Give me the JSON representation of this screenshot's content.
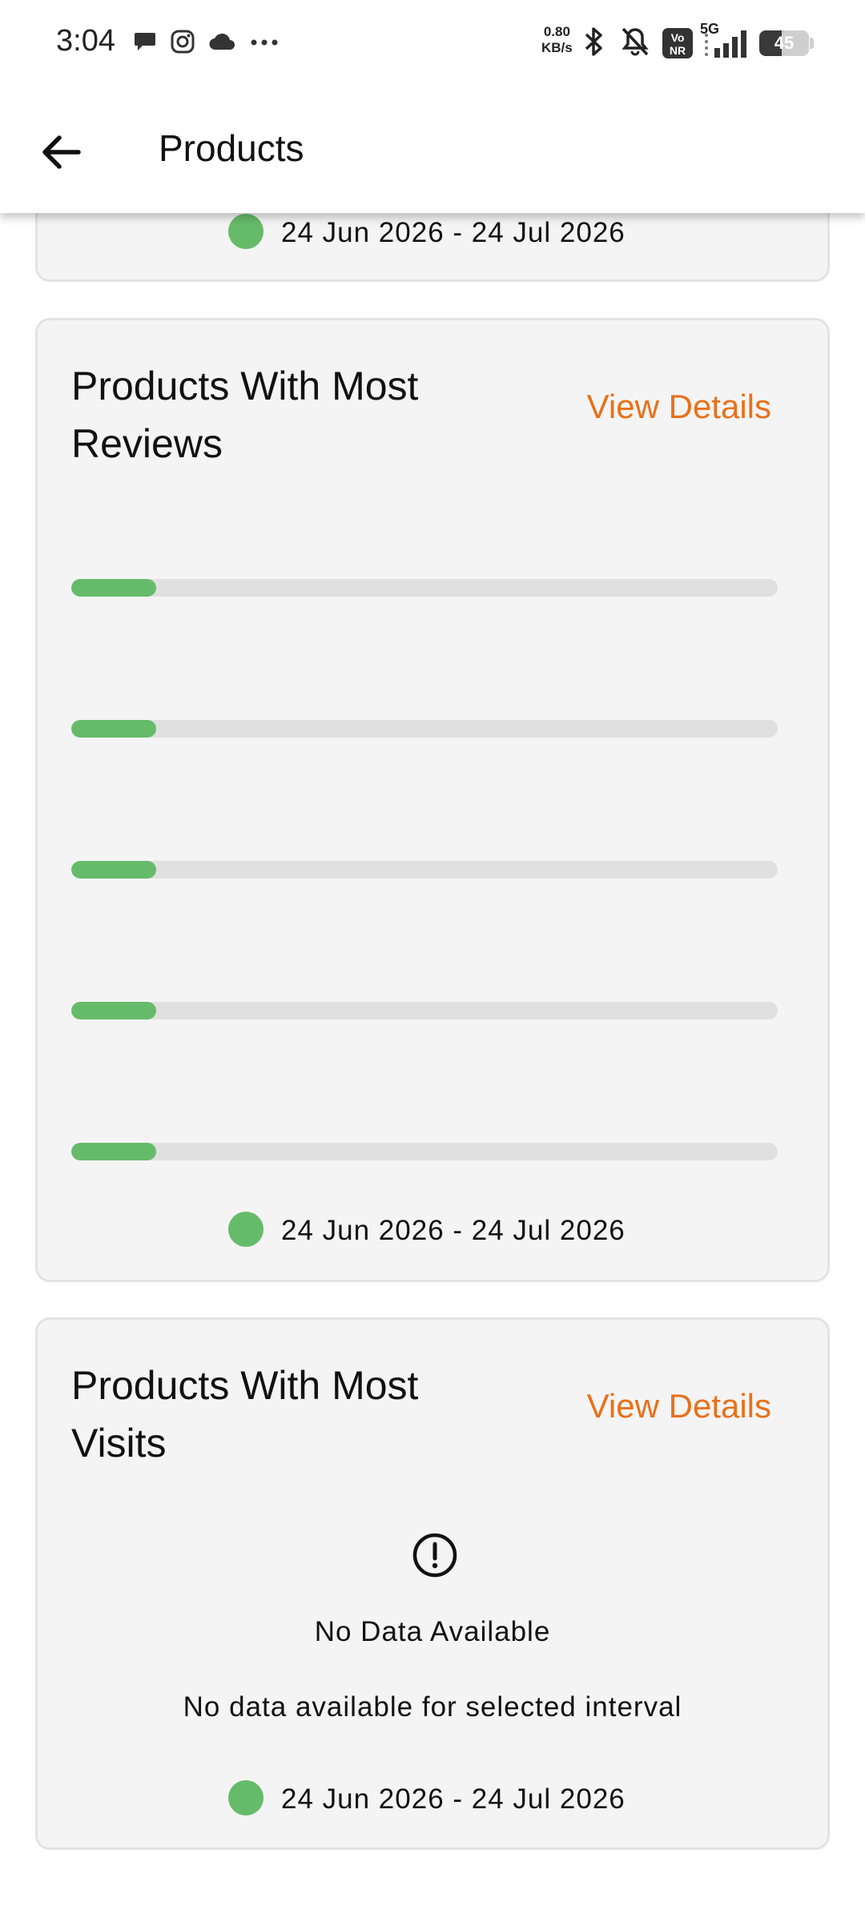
{
  "status_bar": {
    "time": "3:04",
    "net_speed_value": "0.80",
    "net_speed_unit": "KB/s",
    "network": "5G",
    "battery": "45",
    "icons": [
      "chat-icon",
      "instagram-icon",
      "cloud-icon",
      "more-dots-icon",
      "bluetooth-icon",
      "bell-off-icon",
      "volte-icon",
      "signal-icon",
      "battery-icon"
    ]
  },
  "app_bar": {
    "title": "Products",
    "back_icon": "arrow-left-icon"
  },
  "cards": {
    "previous": {
      "date_range": "24 Jun 2026 - 24 Jul 2026"
    },
    "most_reviews": {
      "title": "Products With Most Reviews",
      "view_details": "View Details",
      "date_range": "24 Jun 2026 - 24 Jul 2026",
      "bars_fill_fraction": [
        0.12,
        0.12,
        0.12,
        0.12,
        0.12
      ]
    },
    "most_visits": {
      "title": "Products With Most Visits",
      "view_details": "View Details",
      "empty_icon": "alert-circle-icon",
      "empty_title": "No Data Available",
      "empty_subtitle": "No data available for selected interval",
      "date_range": "24 Jun 2026 - 24 Jul 2026"
    }
  },
  "colors": {
    "accent": "#e8711a",
    "bar_fill": "#66bb6a",
    "bar_track": "#e0e0e0",
    "card_bg": "#f4f4f4"
  }
}
